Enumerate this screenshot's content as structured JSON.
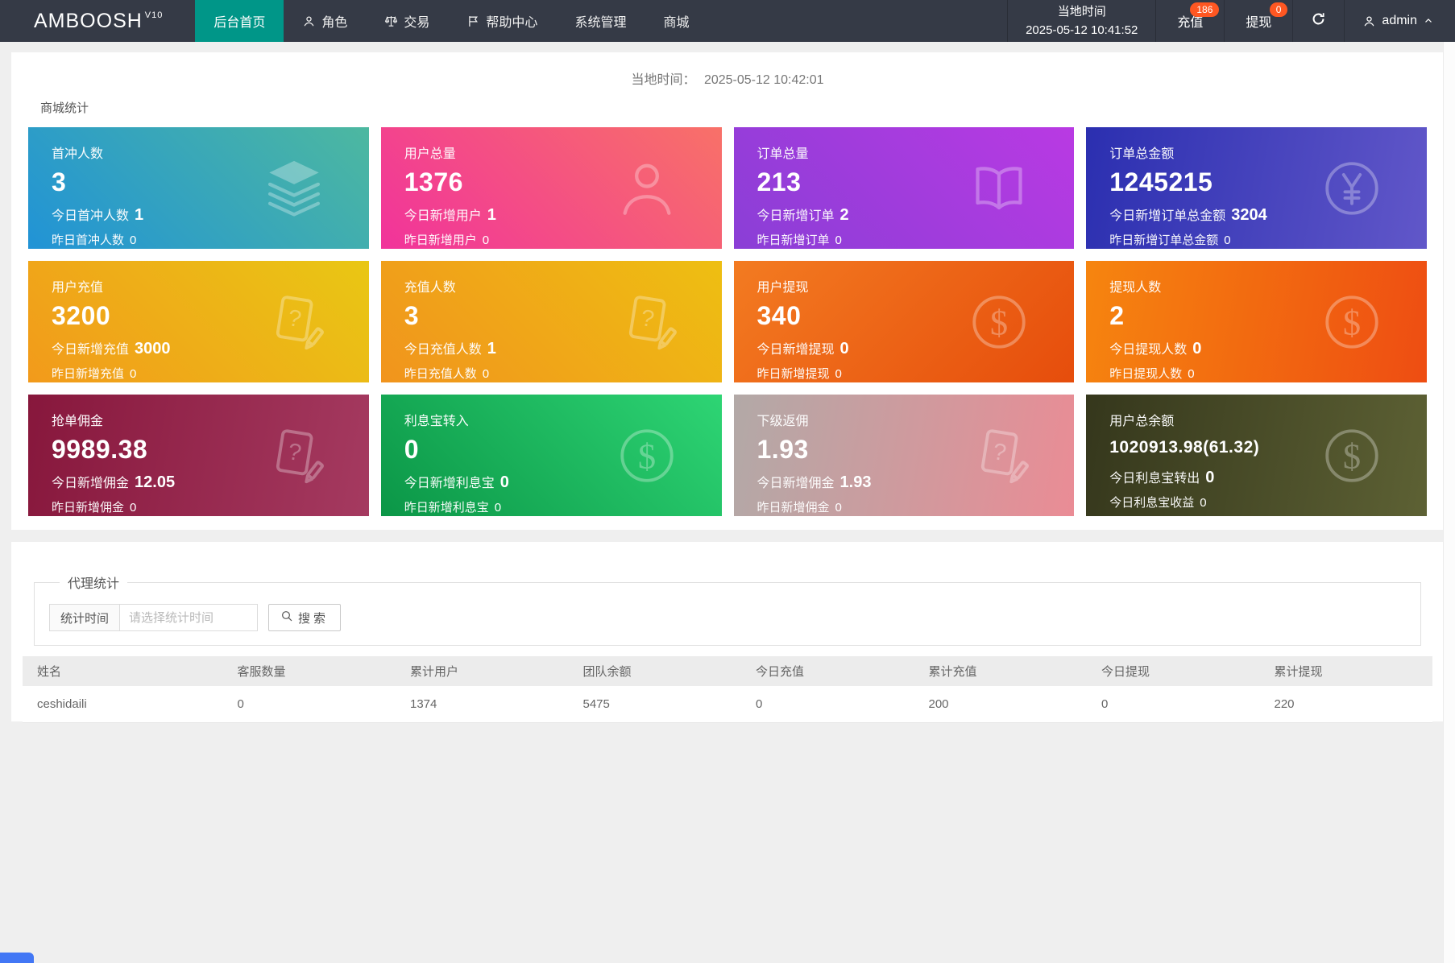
{
  "navbar": {
    "brand": "AMBOOSH",
    "brand_version": "V10",
    "menu": [
      {
        "label": "后台首页",
        "active": true,
        "icon": "none"
      },
      {
        "label": "角色",
        "icon": "user"
      },
      {
        "label": "交易",
        "icon": "scale"
      },
      {
        "label": "帮助中心",
        "icon": "flag"
      },
      {
        "label": "系统管理",
        "icon": "none"
      },
      {
        "label": "商城",
        "icon": "none"
      }
    ],
    "local_time_label": "当地时间",
    "local_time_value": "2025-05-12 10:41:52",
    "recharge": {
      "label": "充值",
      "badge": "186"
    },
    "withdraw": {
      "label": "提现",
      "badge": "0"
    },
    "refresh_icon": "refresh",
    "user_name": "admin"
  },
  "content": {
    "local_time_label": "当地时间：",
    "local_time_value": "2025-05-12 10:42:01",
    "stats_title": "商城统计",
    "cards": [
      {
        "title": "首冲人数",
        "value": "3",
        "today_label": "今日首冲人数",
        "today_value": "1",
        "yesterday_label": "昨日首冲人数",
        "yesterday_value": "0",
        "icon": "layers",
        "gradient": [
          "#2193d6",
          "#4db8a0"
        ]
      },
      {
        "title": "用户总量",
        "value": "1376",
        "today_label": "今日新增用户",
        "today_value": "1",
        "yesterday_label": "昨日新增用户",
        "yesterday_value": "0",
        "icon": "user",
        "gradient": [
          "#f1339b",
          "#f87168"
        ]
      },
      {
        "title": "订单总量",
        "value": "213",
        "today_label": "今日新增订单",
        "today_value": "2",
        "yesterday_label": "昨日新增订单",
        "yesterday_value": "0",
        "icon": "open-book",
        "gradient": [
          "#8a3ed6",
          "#b93ae3"
        ]
      },
      {
        "title": "订单总金额",
        "value": "1245215",
        "today_label": "今日新增订单总金额",
        "today_value": "3204",
        "yesterday_label": "昨日新增订单总金额",
        "yesterday_value": "0",
        "icon": "yen-circle",
        "gradient": [
          "#2b2fb0",
          "#6157c9"
        ]
      },
      {
        "title": "用户充值",
        "value": "3200",
        "today_label": "今日新增充值",
        "today_value": "3000",
        "yesterday_label": "昨日新增充值",
        "yesterday_value": "0",
        "icon": "edit-doc",
        "gradient": [
          "#f29a1b",
          "#e9c714"
        ]
      },
      {
        "title": "充值人数",
        "value": "3",
        "today_label": "今日充值人数",
        "today_value": "1",
        "yesterday_label": "昨日充值人数",
        "yesterday_value": "0",
        "icon": "edit-doc",
        "gradient": [
          "#f1941d",
          "#eebf12"
        ]
      },
      {
        "title": "用户提现",
        "value": "340",
        "today_label": "今日新增提现",
        "today_value": "0",
        "yesterday_label": "昨日新增提现",
        "yesterday_value": "0",
        "icon": "dollar-circle",
        "gradient": [
          "#f37b21",
          "#e64d0c"
        ]
      },
      {
        "title": "提现人数",
        "value": "2",
        "today_label": "今日提现人数",
        "today_value": "0",
        "yesterday_label": "昨日提现人数",
        "yesterday_value": "0",
        "icon": "dollar-circle",
        "gradient": [
          "#f6850f",
          "#ee4d12"
        ]
      },
      {
        "title": "抢单佣金",
        "value": "9989.38",
        "today_label": "今日新增佣金",
        "today_value": "12.05",
        "yesterday_label": "昨日新增佣金",
        "yesterday_value": "0",
        "icon": "edit-doc",
        "gradient": [
          "#87173c",
          "#a53a60"
        ]
      },
      {
        "title": "利息宝转入",
        "value": "0",
        "today_label": "今日新增利息宝",
        "today_value": "0",
        "yesterday_label": "昨日新增利息宝",
        "yesterday_value": "0",
        "icon": "dollar-circle",
        "gradient": [
          "#0b9647",
          "#2ed574"
        ]
      },
      {
        "title": "下级返佣",
        "value": "1.93",
        "today_label": "今日新增佣金",
        "today_value": "1.93",
        "yesterday_label": "昨日新增佣金",
        "yesterday_value": "0",
        "icon": "edit-doc",
        "gradient": [
          "#b2a9a7",
          "#ea8c95"
        ]
      },
      {
        "title": "用户总余额",
        "value": "1020913.98(61.32)",
        "today_label": "今日利息宝转出",
        "today_value": "0",
        "yesterday_label": "今日利息宝收益",
        "yesterday_value": "0",
        "icon": "dollar-circle",
        "gradient": [
          "#35371c",
          "#5d6134"
        ]
      }
    ],
    "agent": {
      "legend": "代理统计",
      "filter_label": "统计时间",
      "filter_placeholder": "请选择统计时间",
      "search_label": "搜索"
    },
    "table": {
      "headers": [
        "姓名",
        "客服数量",
        "累计用户",
        "团队余额",
        "今日充值",
        "累计充值",
        "今日提现",
        "累计提现"
      ],
      "rows": [
        [
          "ceshidaili",
          "0",
          "1374",
          "5475",
          "0",
          "200",
          "0",
          "220"
        ]
      ]
    }
  },
  "colors": {
    "navbar_bg": "#353a46",
    "accent_teal": "#009688",
    "badge_orange": "#ff5722",
    "page_bg": "#efefef"
  }
}
